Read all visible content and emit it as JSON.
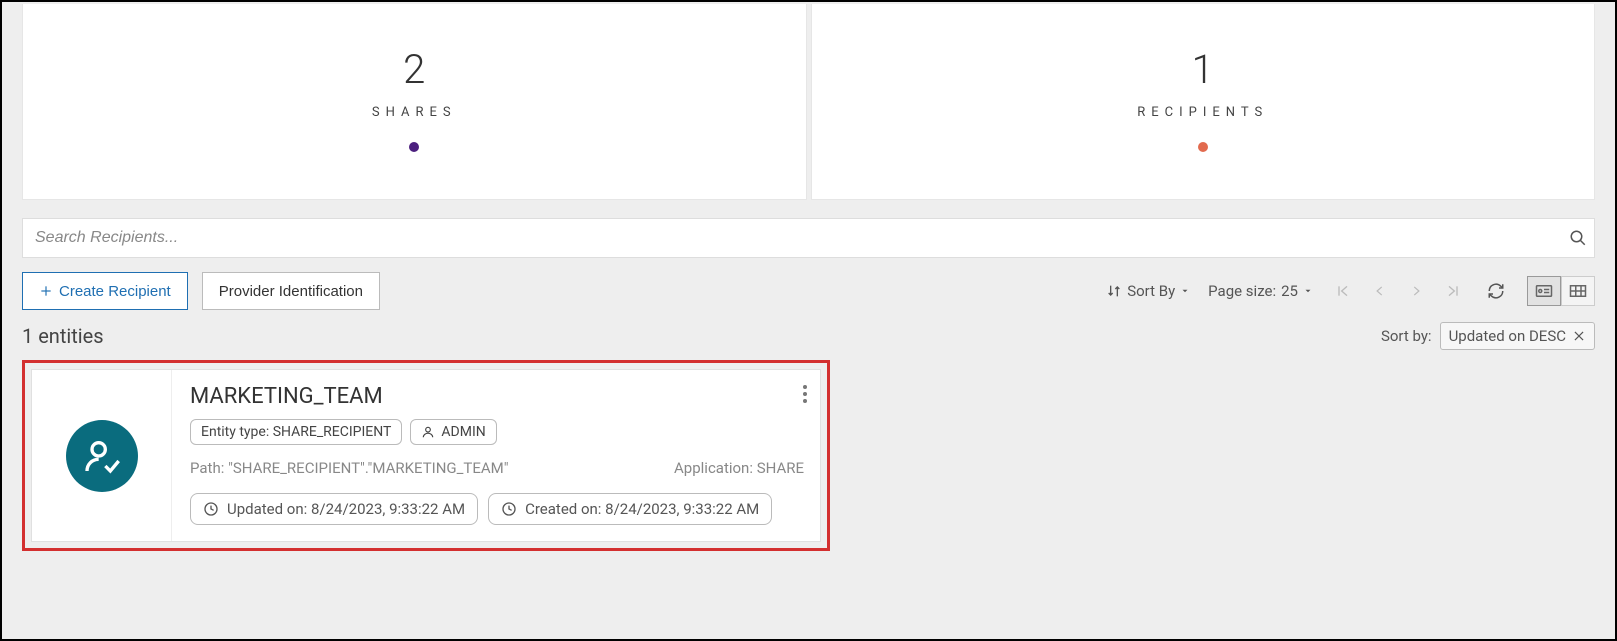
{
  "stats": {
    "shares": {
      "value": "2",
      "label": "SHARES",
      "dot_color": "#4b1f7e"
    },
    "recipients": {
      "value": "1",
      "label": "RECIPIENTS",
      "dot_color": "#e26a4e"
    }
  },
  "search": {
    "placeholder": "Search Recipients..."
  },
  "toolbar": {
    "create_label": "Create Recipient",
    "provider_label": "Provider Identification",
    "sort_by_label": "Sort By",
    "page_size_prefix": "Page size:",
    "page_size_value": "25"
  },
  "entities": {
    "count_label": "1 entities",
    "sort_by_prefix": "Sort by:",
    "sort_chip_label": "Updated on DESC"
  },
  "card": {
    "title": "MARKETING_TEAM",
    "entity_type_label": "Entity type: SHARE_RECIPIENT",
    "owner_label": "ADMIN",
    "path_label": "Path: \"SHARE_RECIPIENT\".\"MARKETING_TEAM\"",
    "application_label": "Application: SHARE",
    "updated_label": "Updated on: 8/24/2023, 9:33:22 AM",
    "created_label": "Created on: 8/24/2023, 9:33:22 AM"
  }
}
